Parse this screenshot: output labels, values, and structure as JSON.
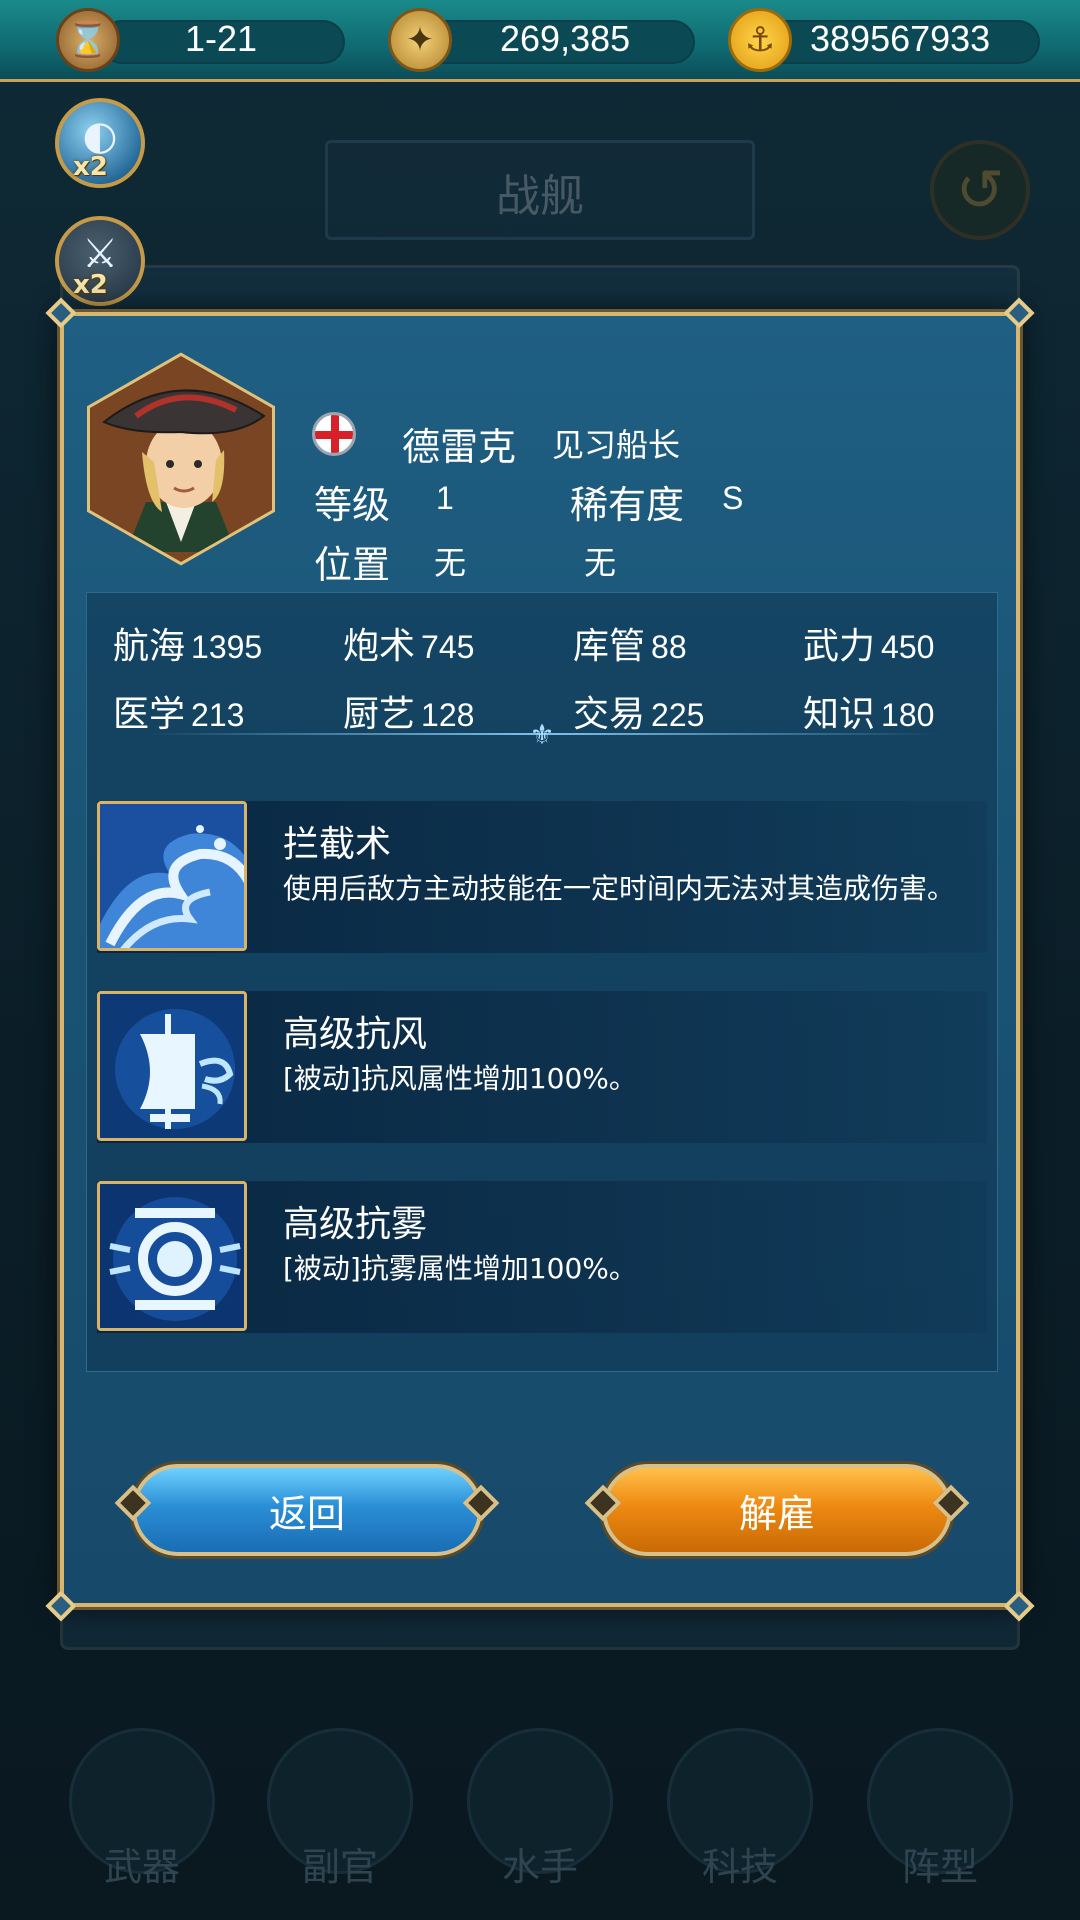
{
  "top_bar": {
    "level": "1-21",
    "gold": "269,385",
    "coins": "389567933"
  },
  "boosts": {
    "search_multiplier": "x2",
    "battle_multiplier": "x2"
  },
  "background": {
    "title": "战舰",
    "nav": [
      "武器",
      "副官",
      "水手",
      "科技",
      "阵型"
    ]
  },
  "officer": {
    "name": "德雷克",
    "rank": "见习船长",
    "level_label": "等级",
    "level": "1",
    "rarity_label": "稀有度",
    "rarity": "S",
    "position_label": "位置",
    "position": "无",
    "position_extra": "无",
    "flag": "england-flag"
  },
  "stats": [
    {
      "label": "航海",
      "value": "1395"
    },
    {
      "label": "炮术",
      "value": "745"
    },
    {
      "label": "库管",
      "value": "88"
    },
    {
      "label": "武力",
      "value": "450"
    },
    {
      "label": "医学",
      "value": "213"
    },
    {
      "label": "厨艺",
      "value": "128"
    },
    {
      "label": "交易",
      "value": "225"
    },
    {
      "label": "知识",
      "value": "180"
    }
  ],
  "skills": [
    {
      "name": "拦截术",
      "desc": "使用后敌方主动技能在一定时间内无法对其造成伤害。",
      "icon": "wave-icon"
    },
    {
      "name": "高级抗风",
      "desc": "[被动]抗风属性增加100%。",
      "icon": "wind-sail-icon"
    },
    {
      "name": "高级抗雾",
      "desc": "[被动]抗雾属性增加100%。",
      "icon": "fog-lantern-icon"
    }
  ],
  "buttons": {
    "back": "返回",
    "dismiss": "解雇"
  }
}
